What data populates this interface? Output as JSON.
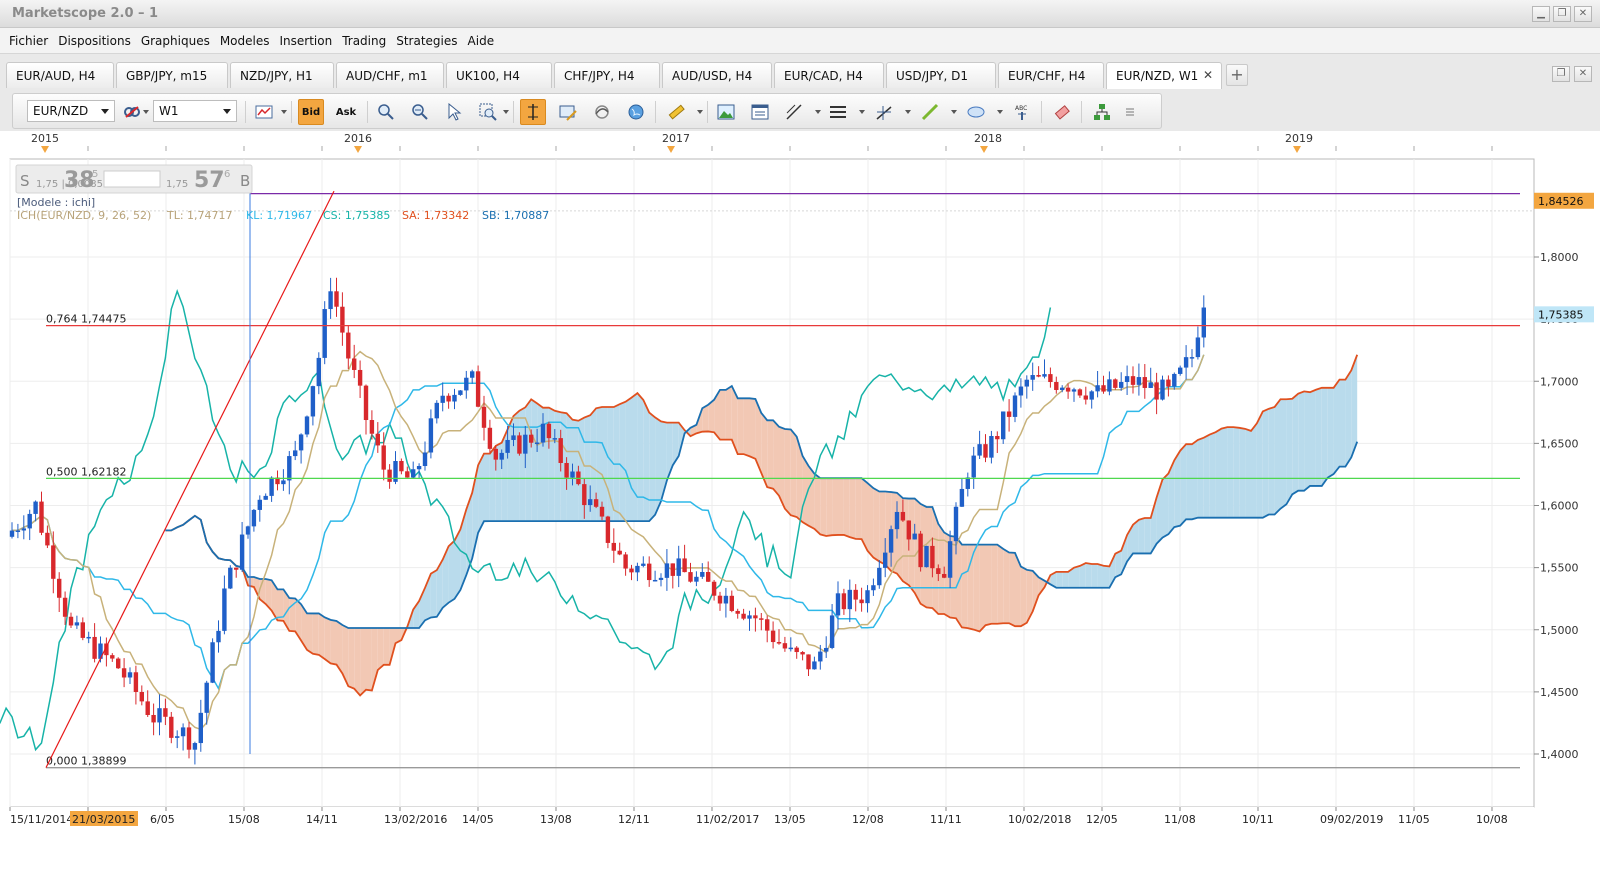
{
  "window": {
    "title": "Marketscope 2.0 – 1",
    "buttons": [
      "minimize",
      "restore",
      "close"
    ]
  },
  "menu": [
    "Fichier",
    "Dispositions",
    "Graphiques",
    "Modeles",
    "Insertion",
    "Trading",
    "Strategies",
    "Aide"
  ],
  "tabs": [
    {
      "label": "EUR/AUD, H4",
      "active": false
    },
    {
      "label": "GBP/JPY, m15",
      "active": false
    },
    {
      "label": "NZD/JPY, H1",
      "active": false
    },
    {
      "label": "AUD/CHF, m1",
      "active": false
    },
    {
      "label": "UK100, H4",
      "active": false
    },
    {
      "label": "CHF/JPY, H4",
      "active": false
    },
    {
      "label": "AUD/USD, H4",
      "active": false
    },
    {
      "label": "EUR/CAD, H4",
      "active": false
    },
    {
      "label": "USD/JPY, D1",
      "active": false
    },
    {
      "label": "EUR/CHF, H4",
      "active": false
    },
    {
      "label": "EUR/NZD, W1",
      "active": true
    }
  ],
  "tab_close_glyph": "✕",
  "tab_add_glyph": "+",
  "toolbar": {
    "symbol": "EUR/NZD",
    "timeframe": "W1",
    "bid_label": "Bid",
    "ask_label": "Ask"
  },
  "chart": {
    "model_label": "[Modele : ichi]",
    "ichimoku": {
      "name": "ICH(EUR/NZD, 9, 26, 52)",
      "tl": "TL: 1,74717",
      "kl": "KL: 1,71967",
      "cs": "CS: 1,75385",
      "sa": "SA: 1,73342",
      "sb": "SB: 1,70887"
    },
    "sell_box": {
      "s_label": "S",
      "b_label": "B",
      "sell_small": "1,75",
      "sell_big": "38",
      "sell_sup": "5",
      "buy_small": "1,75",
      "buy_big": "57",
      "buy_sup": "6",
      "amount": "1,75 | 0,00854"
    },
    "years": [
      "2015",
      "2016",
      "2017",
      "2018",
      "2019"
    ],
    "fibo": [
      {
        "label": "0,764 1,74475",
        "price": 1.74475,
        "color": "#e83a3a"
      },
      {
        "label": "0,500 1,62182",
        "price": 1.62182,
        "color": "#4fd84f"
      },
      {
        "label": "0,000 1,38899",
        "price": 1.38899,
        "color": "#9a9a9a"
      }
    ],
    "upper_line_price": 1.851,
    "price_badges": [
      {
        "label": "1,84526",
        "price": 1.84526,
        "bg": "#f3a640"
      },
      {
        "label": "1,75385",
        "price": 1.75385,
        "bg": "#bfe6f7"
      }
    ],
    "price_axis": [
      "1,8000",
      "1,7500",
      "1,7000",
      "1,6500",
      "1,6000",
      "1,5500",
      "1,5000",
      "1,4500",
      "1,4000"
    ],
    "date_axis": [
      "15/11/2014",
      "21/03/2015",
      "6/05",
      "15/08",
      "14/11",
      "13/02/2016",
      "14/05",
      "13/08",
      "12/11",
      "11/02/2017",
      "13/05",
      "12/08",
      "11/11",
      "10/02/2018",
      "12/05",
      "11/08",
      "10/11",
      "09/02/2019",
      "11/05",
      "10/08"
    ],
    "highlight_date": "21/03/2015",
    "colors": {
      "up_candle": "#1f5fc8",
      "down_candle": "#d8282c",
      "tenkan": "#c8b27a",
      "kijun": "#2fb8e8",
      "chikou": "#17b3a8",
      "senkou_a": "#e0501e",
      "senkou_b": "#1a6fb0",
      "cloud_bull": "#b9dbec",
      "cloud_bear": "#f2c8b4"
    }
  }
}
